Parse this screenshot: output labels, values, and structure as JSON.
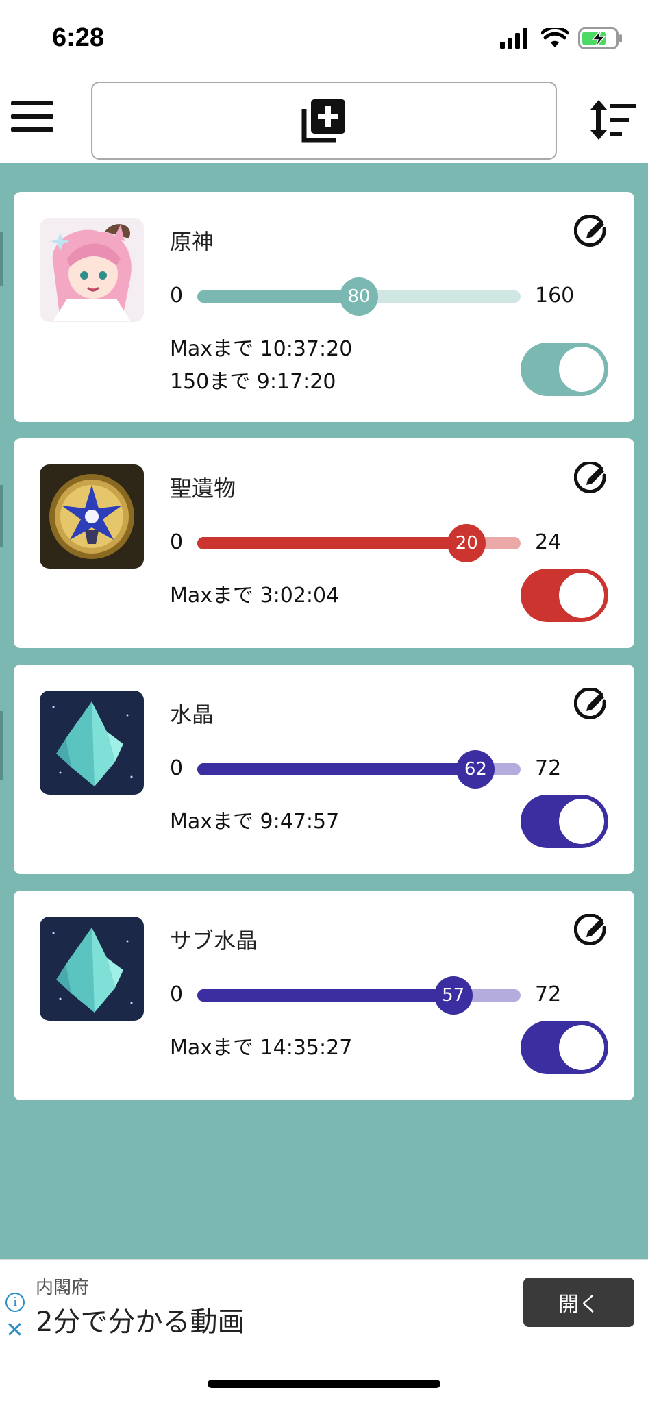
{
  "status_bar": {
    "time": "6:28"
  },
  "header": {
    "menu_icon": "hamburger-menu-icon",
    "add_icon": "library-add-icon",
    "sort_icon": "sort-icon"
  },
  "trackers": [
    {
      "title": "原神",
      "icon": "resin-character-icon",
      "min": "0",
      "max": "160",
      "value": "80",
      "fraction": 0.5,
      "color": "#7bb8b2",
      "light_color": "#cfe6e3",
      "lines": [
        "Maxまで 10:37:20",
        "150まで 9:17:20"
      ],
      "toggle_on": true
    },
    {
      "title": "聖遺物",
      "icon": "artifact-flower-icon",
      "min": "0",
      "max": "24",
      "value": "20",
      "fraction": 0.8333,
      "color": "#cc3430",
      "light_color": "#eaa9a6",
      "lines": [
        "Maxまで 3:02:04"
      ],
      "toggle_on": true
    },
    {
      "title": "水晶",
      "icon": "crystal-icon",
      "min": "0",
      "max": "72",
      "value": "62",
      "fraction": 0.8611,
      "color": "#3a2ea0",
      "light_color": "#b3acdc",
      "lines": [
        "Maxまで 9:47:57"
      ],
      "toggle_on": true
    },
    {
      "title": "サブ水晶",
      "icon": "crystal-icon",
      "min": "0",
      "max": "72",
      "value": "57",
      "fraction": 0.7917,
      "color": "#3a2ea0",
      "light_color": "#b3acdc",
      "lines": [
        "Maxまで 14:35:27"
      ],
      "toggle_on": true
    }
  ],
  "ad": {
    "sponsor": "内閣府",
    "title": "2分で分かる動画",
    "button": "開く"
  }
}
